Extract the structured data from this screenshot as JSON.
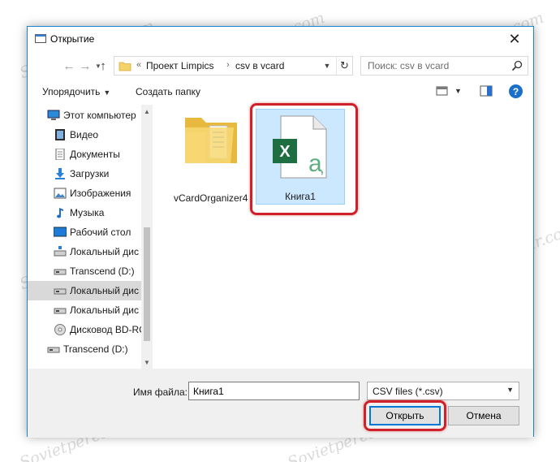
{
  "window": {
    "title": "Открытие"
  },
  "navigation": {
    "address_crumbs": [
      "Проект Limpics",
      "csv в vcard"
    ],
    "search_placeholder": "Поиск: csv в vcard"
  },
  "toolbar": {
    "organize_label": "Упорядочить",
    "new_folder_label": "Создать папку"
  },
  "sidebar": {
    "items": [
      {
        "label": "Этот компьютер",
        "icon": "computer-icon"
      },
      {
        "label": "Видео",
        "icon": "video-icon"
      },
      {
        "label": "Документы",
        "icon": "documents-icon"
      },
      {
        "label": "Загрузки",
        "icon": "downloads-icon"
      },
      {
        "label": "Изображения",
        "icon": "pictures-icon"
      },
      {
        "label": "Музыка",
        "icon": "music-icon"
      },
      {
        "label": "Рабочий стол",
        "icon": "desktop-icon"
      },
      {
        "label": "Локальный дис",
        "icon": "local-disk-icon"
      },
      {
        "label": "Transcend (D:)",
        "icon": "drive-icon"
      },
      {
        "label": "Локальный дис",
        "icon": "local-disk-icon"
      },
      {
        "label": "Локальный дис",
        "icon": "local-disk-icon"
      },
      {
        "label": "Дисковод BD-RO",
        "icon": "disc-drive-icon"
      },
      {
        "label": "Transcend (D:)",
        "icon": "drive-icon"
      }
    ]
  },
  "files": [
    {
      "name": "vCardOrganizer4",
      "type": "folder"
    },
    {
      "name": "Книга1",
      "type": "excel-csv"
    }
  ],
  "footer": {
    "filename_label": "Имя файла:",
    "filename_value": "Книга1",
    "filter_value": "CSV files (*.csv)",
    "open_label": "Открыть",
    "cancel_label": "Отмена"
  },
  "watermark": "Sovietpereair.com",
  "colors": {
    "accent": "#1883d7",
    "selection": "#cce8ff",
    "highlight_frame": "#d0202a",
    "excel_green": "#1d6f42"
  }
}
